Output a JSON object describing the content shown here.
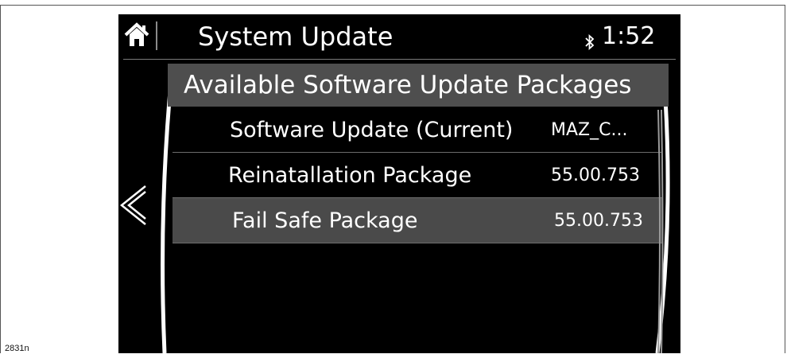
{
  "figure_id": "2831n",
  "header": {
    "title": "System Update",
    "time": "1:52",
    "home_icon": "home-icon",
    "bluetooth_icon": "bluetooth-icon"
  },
  "panel": {
    "title": "Available Software Update Packages"
  },
  "list": {
    "items": [
      {
        "label": "Software Update (Current)",
        "value": "MAZ_C...",
        "selected": false
      },
      {
        "label": "Reinatallation Package",
        "value": "55.00.753",
        "selected": false
      },
      {
        "label": "Fail Safe Package",
        "value": "55.00.753",
        "selected": true
      }
    ]
  },
  "navigation": {
    "back_icon": "chevron-left-icon"
  },
  "colors": {
    "screen_background": "#000000",
    "header_bar": "#4e4e4e",
    "selected_row": "#4a4a4a",
    "text": "#ffffff"
  }
}
